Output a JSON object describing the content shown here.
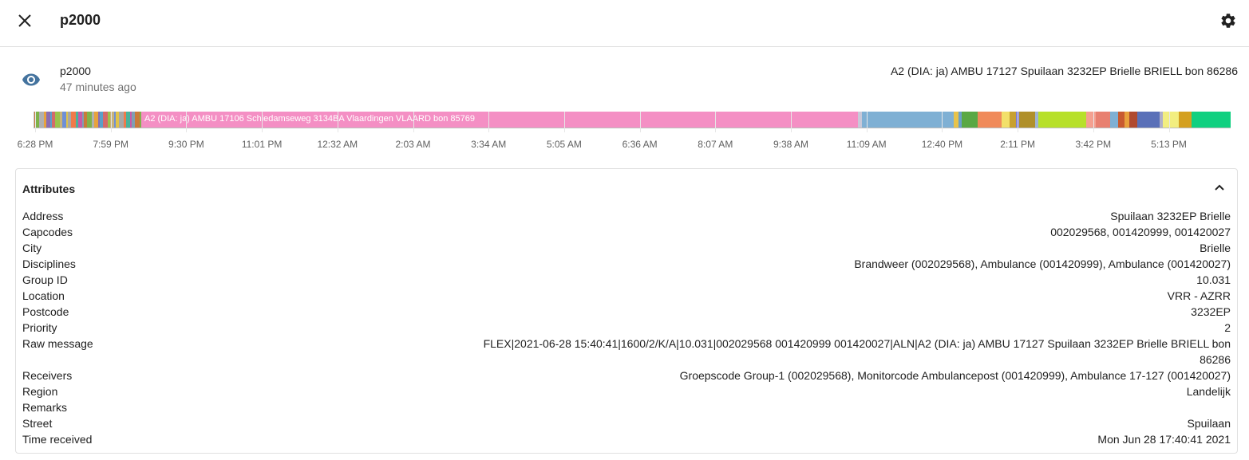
{
  "dialog": {
    "title": "p2000"
  },
  "entity": {
    "name": "p2000",
    "last_changed": "47 minutes ago",
    "state": "A2 (DIA: ja) AMBU 17127 Spuilaan 3232EP Brielle BRIELL bon 86286"
  },
  "history": {
    "hover_label": "A2 (DIA: ja) AMBU 17106 Schiedamseweg 3134BA Vlaardingen VLAARD bon 85769",
    "ticks": [
      "6:28 PM",
      "7:59 PM",
      "9:30 PM",
      "11:01 PM",
      "12:32 AM",
      "2:03 AM",
      "3:34 AM",
      "5:05 AM",
      "6:36 AM",
      "8:07 AM",
      "9:38 AM",
      "11:09 AM",
      "12:40 PM",
      "2:11 PM",
      "3:42 PM",
      "5:13 PM"
    ],
    "main_color": "#f48fc4"
  },
  "attributes": {
    "title": "Attributes",
    "items": [
      {
        "key": "Address",
        "value": "Spuilaan 3232EP Brielle"
      },
      {
        "key": "Capcodes",
        "value": "002029568, 001420999, 001420027"
      },
      {
        "key": "City",
        "value": "Brielle"
      },
      {
        "key": "Disciplines",
        "value": "Brandweer (002029568), Ambulance (001420999), Ambulance (001420027)"
      },
      {
        "key": "Group ID",
        "value": "10.031"
      },
      {
        "key": "Location",
        "value": "VRR - AZRR"
      },
      {
        "key": "Postcode",
        "value": "3232EP"
      },
      {
        "key": "Priority",
        "value": "2"
      },
      {
        "key": "Raw message",
        "value": "FLEX|2021-06-28 15:40:41|1600/2/K/A|10.031|002029568 001420999 001420027|ALN|A2 (DIA: ja) AMBU 17127 Spuilaan 3232EP Brielle BRIELL bon 86286"
      },
      {
        "key": "Receivers",
        "value": "Groepscode Group-1 (002029568), Monitorcode Ambulancepost (001420999), Ambulance 17-127 (001420027)"
      },
      {
        "key": "Region",
        "value": "Landelijk"
      },
      {
        "key": "Remarks",
        "value": ""
      },
      {
        "key": "Street",
        "value": "Spuilaan"
      },
      {
        "key": "Time received",
        "value": "Mon Jun 28 17:40:41 2021"
      }
    ]
  }
}
